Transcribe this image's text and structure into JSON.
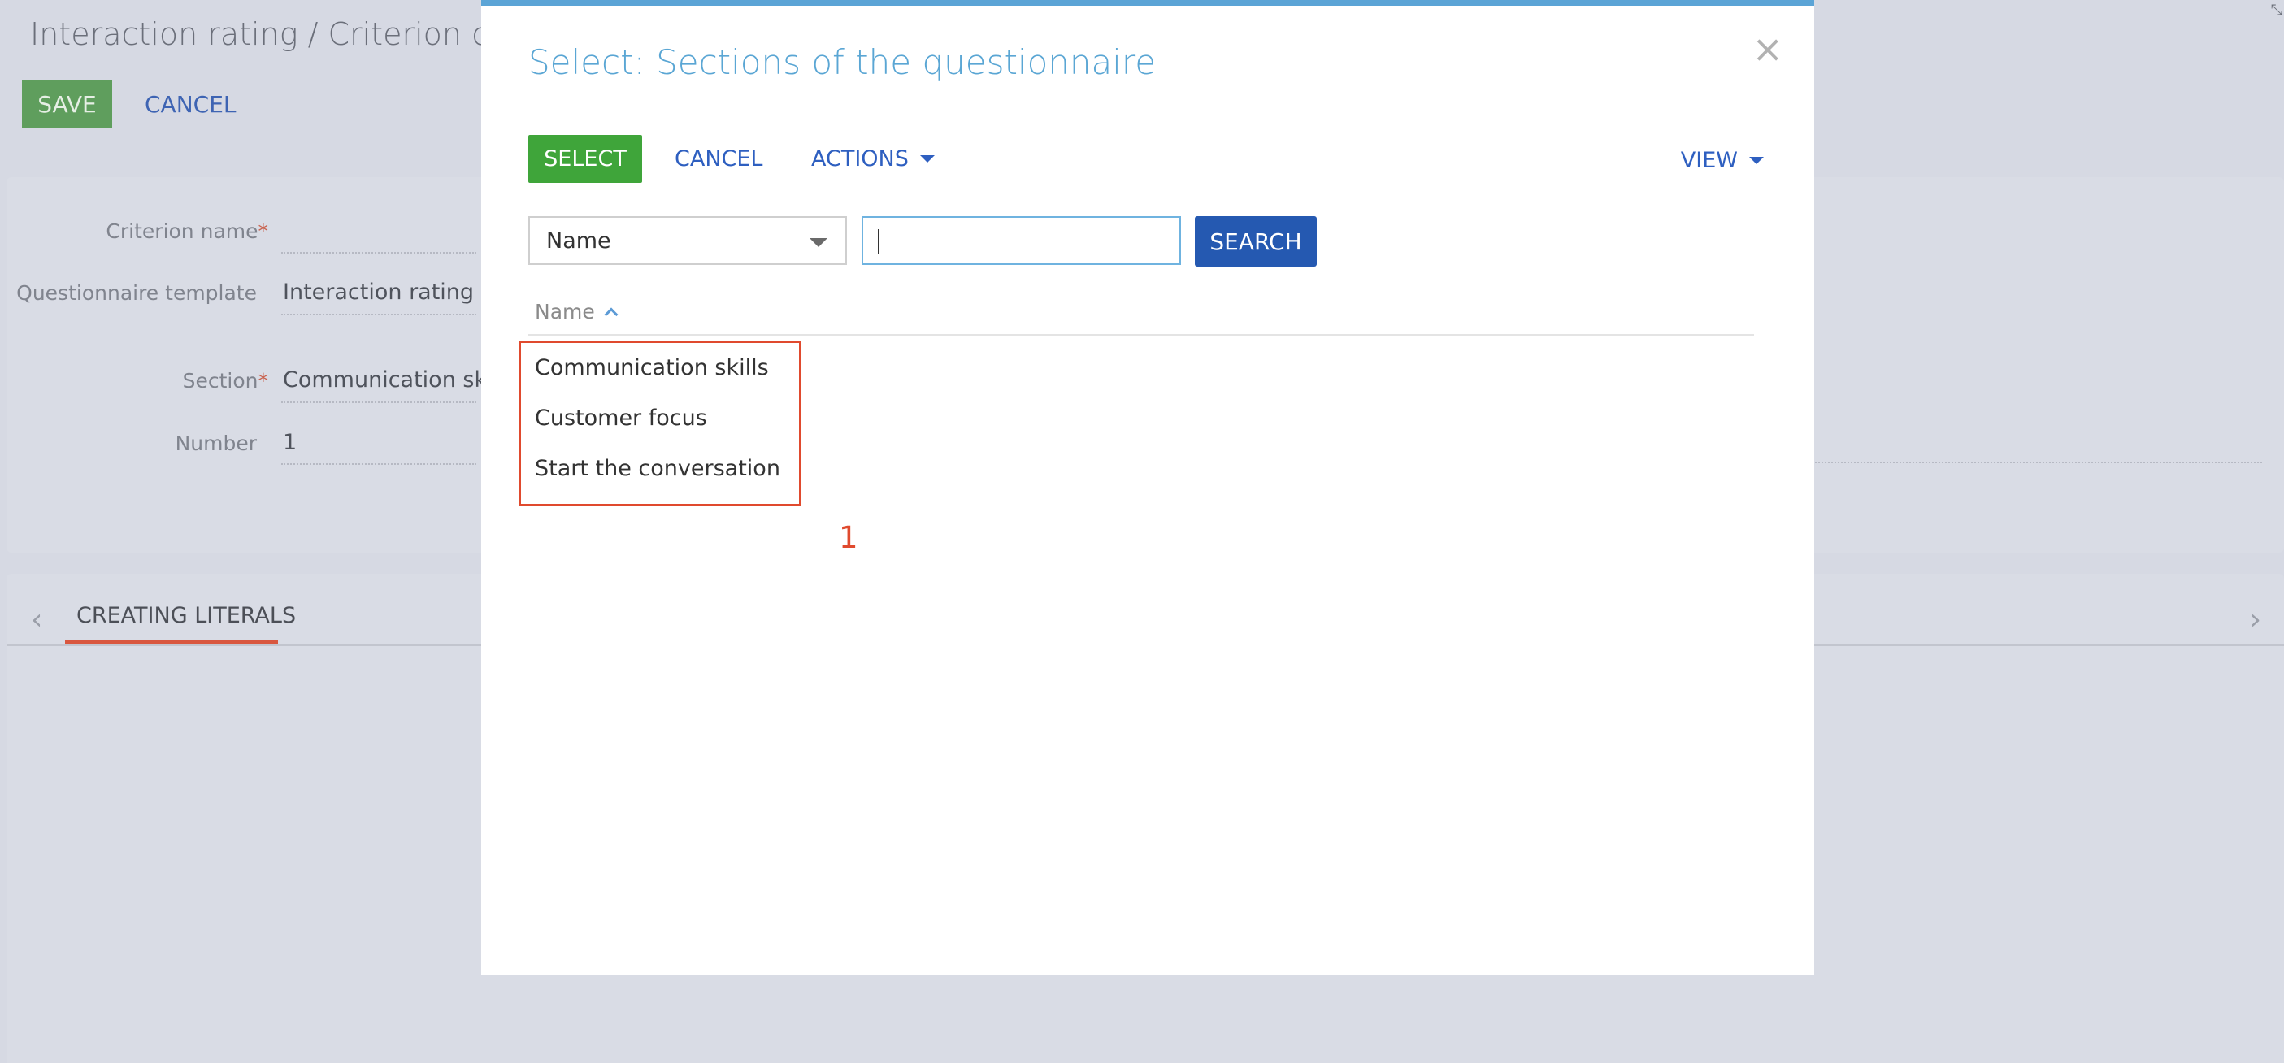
{
  "background": {
    "title": "Interaction rating / Criterion detai",
    "save_label": "SAVE",
    "cancel_label": "CANCEL",
    "fields": {
      "criterion_name_label": "Criterion name",
      "criterion_name_value": "",
      "questionnaire_template_label": "Questionnaire template",
      "questionnaire_template_value": "Interaction rating",
      "section_label": "Section",
      "section_value": "Communication skill",
      "number_label": "Number",
      "number_value": "1",
      "required_marker": "*"
    },
    "tab_label": "CREATING LITERALS",
    "tab_prev_icon": "‹",
    "tab_next_icon": "›",
    "accent_color": "#d9573f"
  },
  "modal": {
    "title": "Select: Sections of the questionnaire",
    "close_glyph": "×",
    "toolbar": {
      "select_label": "SELECT",
      "cancel_label": "CANCEL",
      "actions_label": "ACTIONS",
      "view_label": "VIEW"
    },
    "filter": {
      "column_selected": "Name",
      "search_value": "",
      "search_button": "SEARCH"
    },
    "list": {
      "column_header": "Name",
      "rows": [
        "Communication skills",
        "Customer focus",
        "Start the conversation"
      ]
    },
    "annotation_number": "1",
    "colors": {
      "title": "#5aa6d4",
      "select_button": "#3fa53a",
      "search_button": "#2559b1",
      "link": "#2e5fc0",
      "annotation": "#e04a2e"
    }
  }
}
